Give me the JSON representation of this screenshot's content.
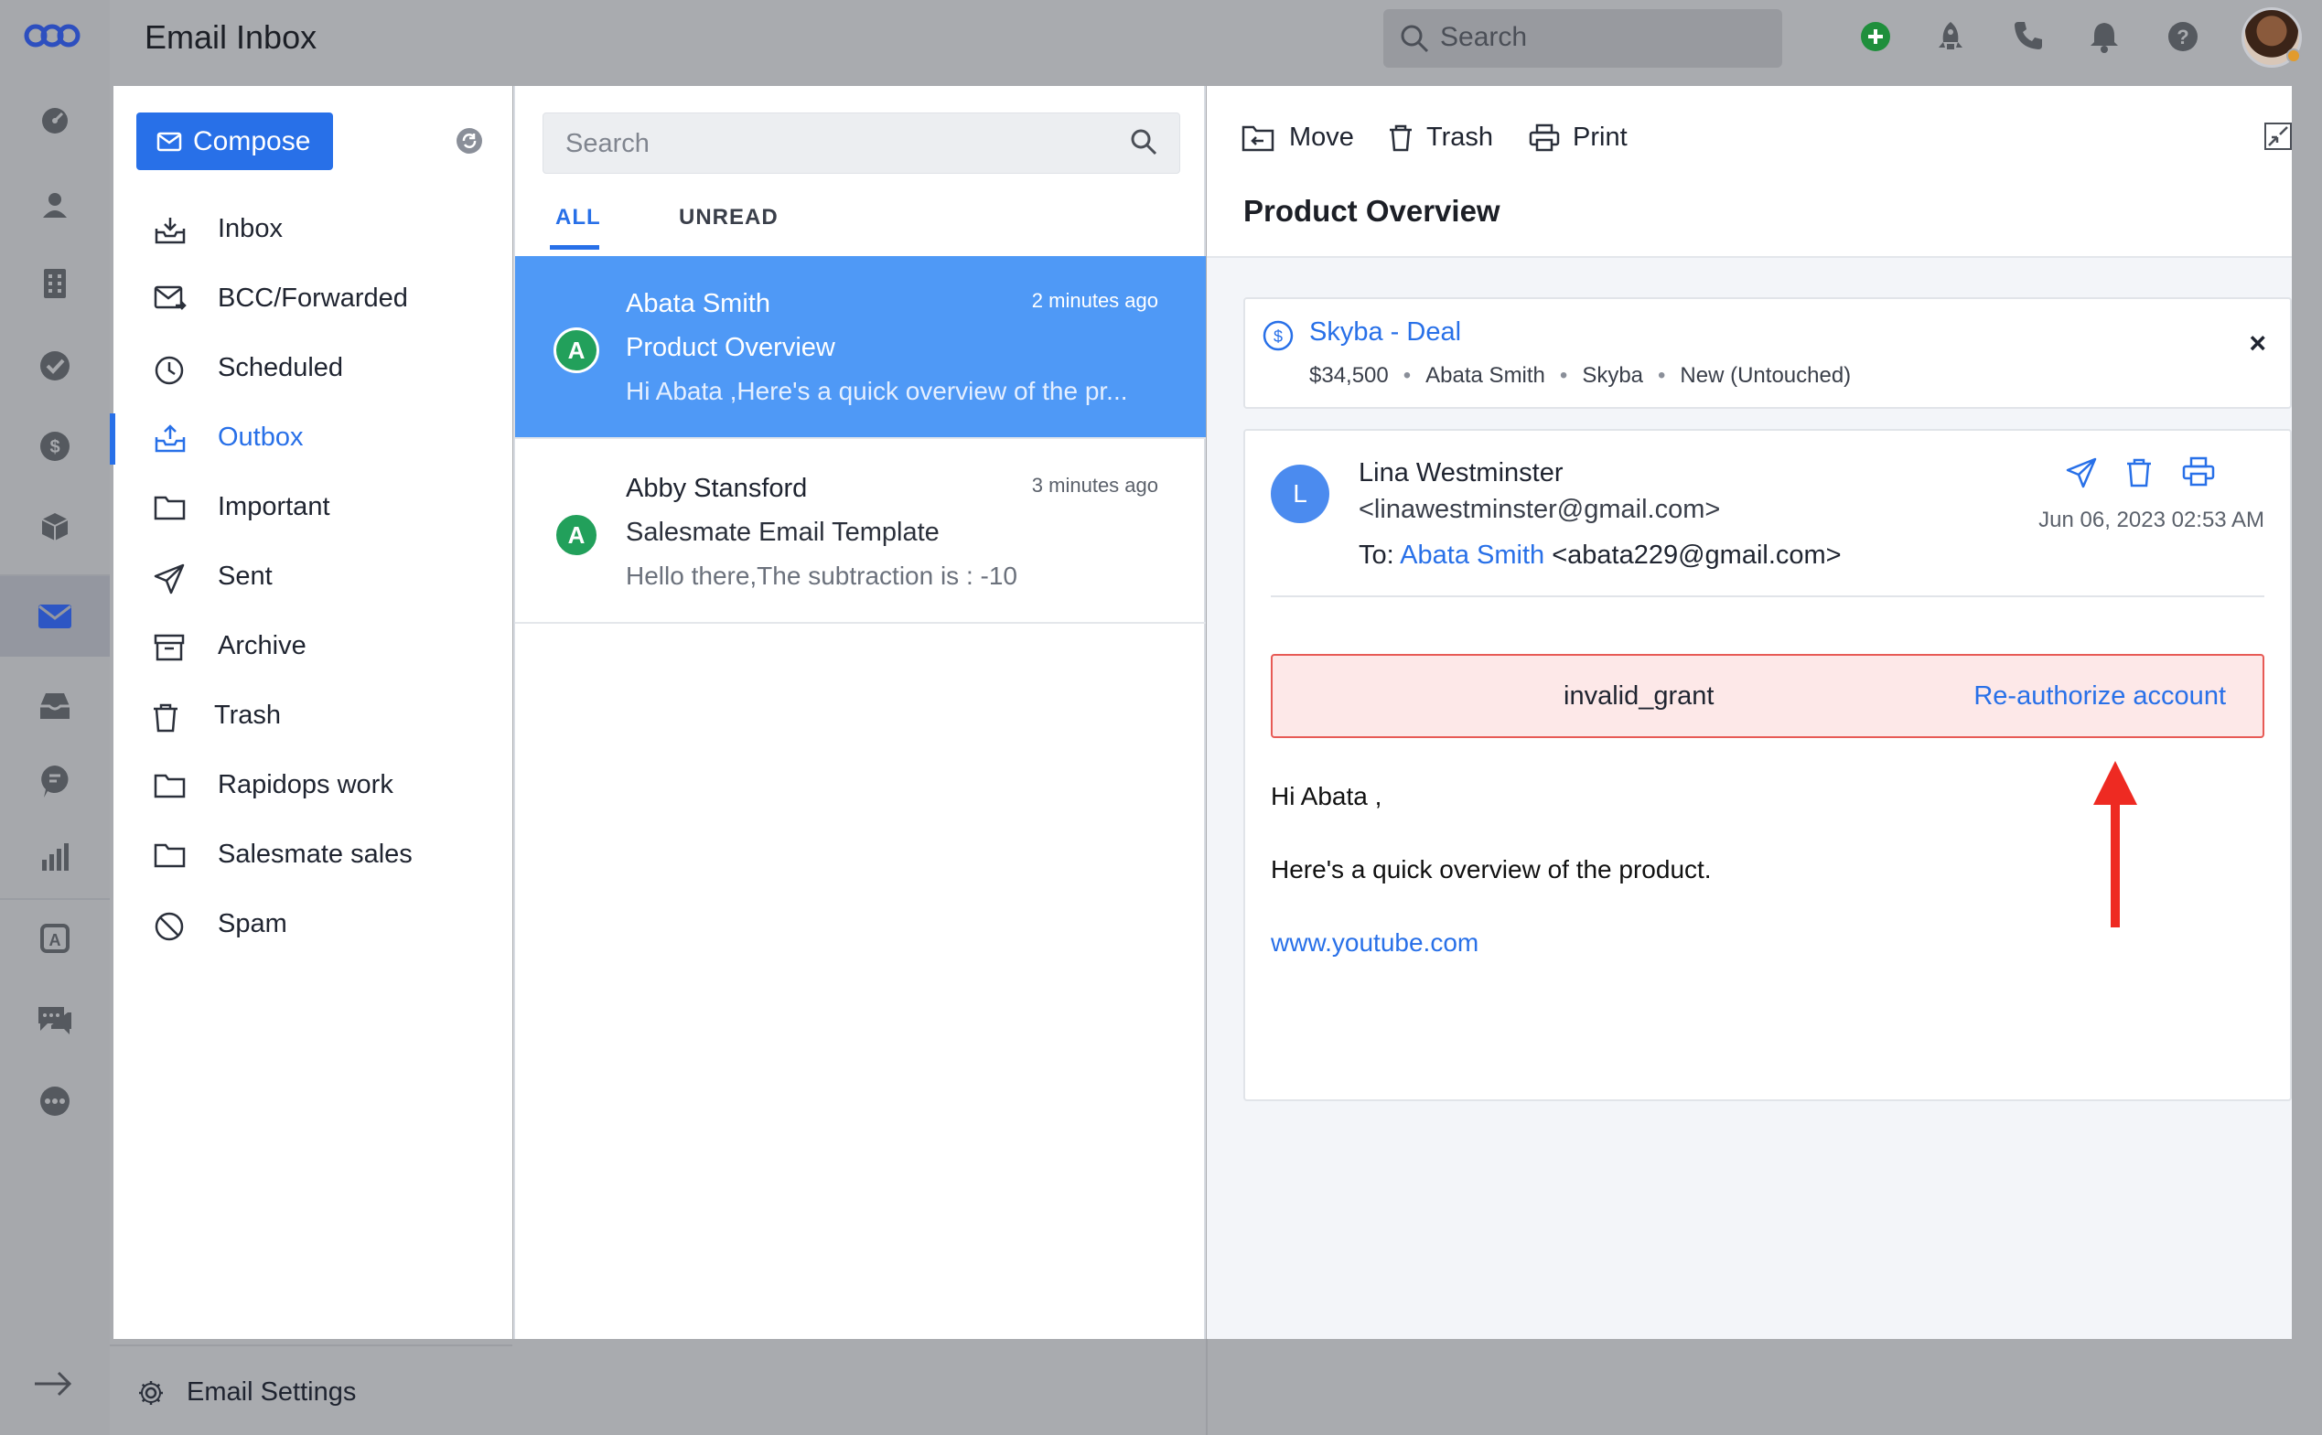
{
  "app": {
    "title": "Email Inbox"
  },
  "topbar": {
    "search_placeholder": "Search",
    "icons": [
      "plus-circle-icon",
      "rocket-icon",
      "phone-icon",
      "bell-icon",
      "help-icon"
    ]
  },
  "rail": {
    "icons": [
      "dashboard-icon",
      "contact-icon",
      "company-icon",
      "task-icon",
      "deal-icon",
      "product-icon",
      "email-icon",
      "inbox-icon",
      "chat-icon",
      "reports-icon",
      "automation-icon",
      "messages-icon",
      "more-icon"
    ],
    "active": "email-icon"
  },
  "folders": {
    "compose_label": "Compose",
    "items": [
      {
        "label": "Inbox",
        "icon": "inbox-tray-icon"
      },
      {
        "label": "BCC/Forwarded",
        "icon": "envelope-forward-icon"
      },
      {
        "label": "Scheduled",
        "icon": "clock-icon"
      },
      {
        "label": "Outbox",
        "icon": "outbox-tray-icon",
        "active": true
      },
      {
        "label": "Important",
        "icon": "folder-icon"
      },
      {
        "label": "Sent",
        "icon": "paper-plane-icon"
      },
      {
        "label": "Archive",
        "icon": "archive-box-icon"
      },
      {
        "label": "Trash",
        "icon": "trash-icon"
      },
      {
        "label": "Rapidops work",
        "icon": "folder-icon"
      },
      {
        "label": "Salesmate sales",
        "icon": "folder-icon"
      },
      {
        "label": "Spam",
        "icon": "block-icon"
      }
    ],
    "settings_label": "Email Settings"
  },
  "message_list": {
    "search_placeholder": "Search",
    "tabs": {
      "all": "ALL",
      "unread": "UNREAD"
    },
    "messages": [
      {
        "avatar": "A",
        "from": "Abata Smith",
        "time": "2 minutes ago",
        "subject": "Product Overview",
        "preview": "Hi Abata ,Here's a quick overview of the pr...",
        "selected": true
      },
      {
        "avatar": "A",
        "from": "Abby Stansford",
        "time": "3 minutes ago",
        "subject": "Salesmate Email Template",
        "preview": "Hello there,The subtraction is : -10",
        "selected": false
      }
    ]
  },
  "reading": {
    "toolbar": {
      "move": "Move",
      "trash": "Trash",
      "print": "Print"
    },
    "title": "Product Overview",
    "deal": {
      "title": "Skyba - Deal",
      "amount": "$34,500",
      "contact": "Abata Smith",
      "company": "Skyba",
      "stage": "New (Untouched)",
      "close": "×"
    },
    "email": {
      "avatar": "L",
      "sender_name": "Lina Westminster",
      "sender_email": "<linawestminster@gmail.com>",
      "to_label": "To:",
      "to_name": "Abata Smith",
      "to_email": "<abata229@gmail.com>",
      "date": "Jun 06, 2023 02:53 AM",
      "alert_text": "invalid_grant",
      "alert_link": "Re-authorize account",
      "body_greeting": "Hi Abata ,",
      "body_text": "Here's a quick overview of the product.",
      "body_link": "www.youtube.com"
    }
  },
  "colors": {
    "accent": "#2870e8",
    "selected_row": "#4f99f6",
    "alert_bg": "#fde8e8",
    "alert_border": "#e75a55",
    "annotation_arrow": "#ee2a22"
  }
}
